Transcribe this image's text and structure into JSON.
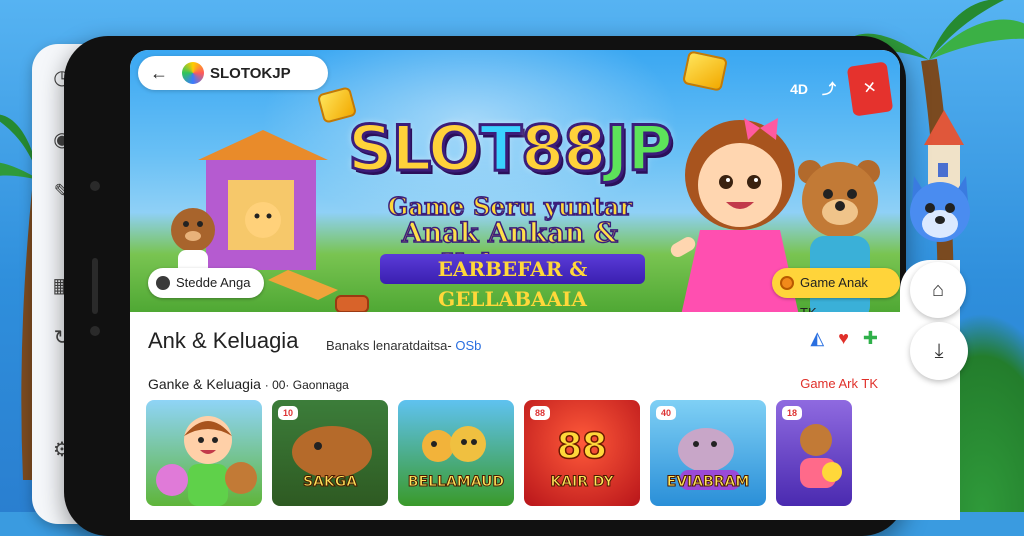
{
  "browser": {
    "back_icon": "arrow-left-icon",
    "site_title": "SLOTOKJP",
    "top_right_label": "4D"
  },
  "hero": {
    "title_parts": [
      "SLO",
      "T",
      "88",
      "JP"
    ],
    "subtitle_1": "Game Seru yuntar",
    "subtitle_2": "Anak Ankan & Keluagra",
    "subtitle_3": "EARBEFAR & GELLABAAIA",
    "pill_left": "Stedde Anga",
    "pill_right": "Game Anak TK"
  },
  "section": {
    "title": "Ank & Keluagia",
    "tag_text": "Banaks lenaratdaitsa-",
    "tag_highlight": "OSb",
    "row_title": "Ganke & Keluagia",
    "row_title_suffix": "· 00· Gaonnaga",
    "row_link": "Game Ark TK"
  },
  "cards": [
    {
      "label": "",
      "badge": "",
      "bg": "#7cc8f2"
    },
    {
      "label": "SAKGA",
      "badge": "10",
      "bg": "#3c7d3a"
    },
    {
      "label": "BELLAMAUD",
      "badge": "",
      "bg": "#4aa33b"
    },
    {
      "label": "KAIR DY",
      "badge": "88",
      "bg": "#d8262a"
    },
    {
      "label": "EVIABRAM",
      "badge": "40",
      "bg": "#3fa6e8"
    },
    {
      "label": "",
      "badge": "18",
      "bg": "#6a4ad0"
    }
  ],
  "colors": {
    "accent_red": "#e0302a",
    "accent_blue": "#2a6fe0",
    "pill_yellow": "#ffd43a"
  },
  "side_buttons": {
    "home_icon": "home-icon",
    "down_icon": "download-icon"
  }
}
